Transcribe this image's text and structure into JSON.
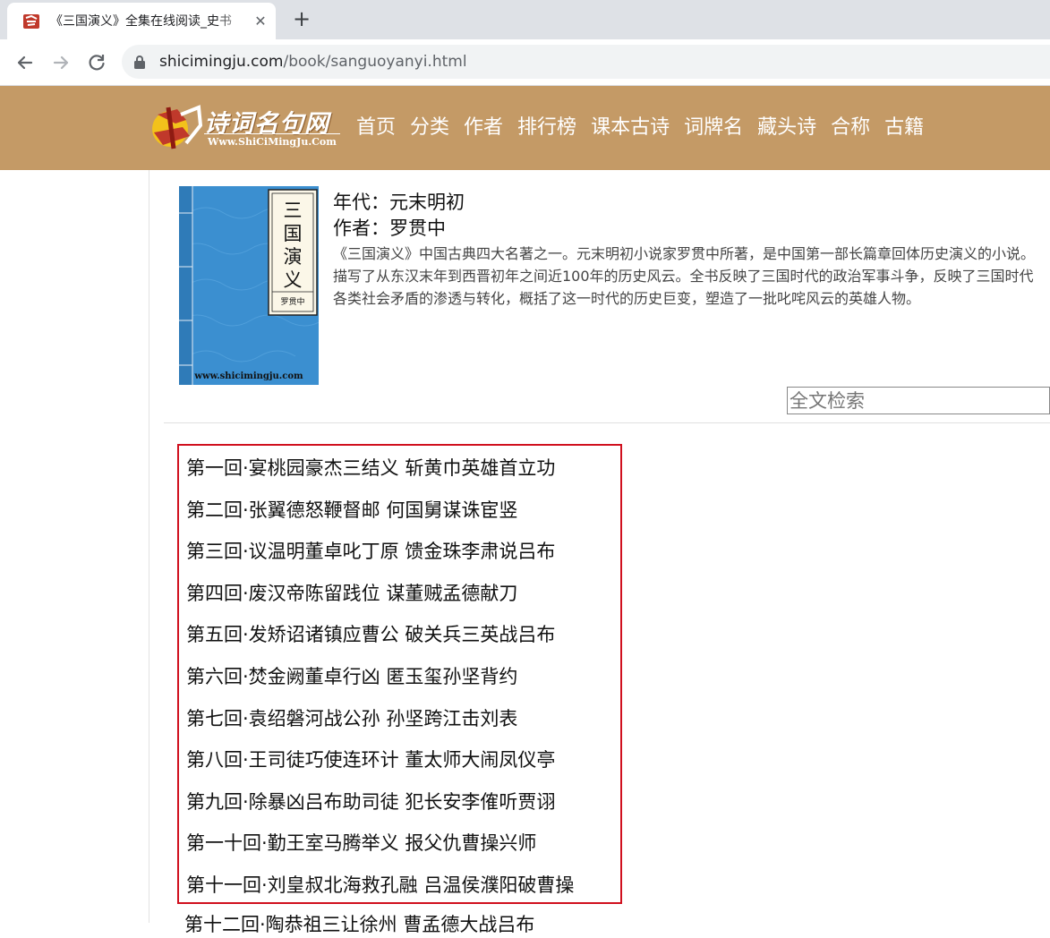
{
  "browser": {
    "tab_title": "《三国演义》全集在线阅读_史书",
    "close_glyph": "✕",
    "new_tab_glyph": "+",
    "url_host": "shicimingju.com",
    "url_path": "/book/sanguoyanyi.html"
  },
  "site": {
    "logo_text": "诗词名句网",
    "logo_url": "Www.ShiCiMingJu.Com",
    "nav": [
      "首页",
      "分类",
      "作者",
      "排行榜",
      "课本古诗",
      "词牌名",
      "藏头诗",
      "合称",
      "古籍"
    ]
  },
  "book": {
    "cover_title_chars": [
      "三",
      "国",
      "演",
      "义"
    ],
    "cover_author": "罗贯中",
    "cover_site": "www.shicimingju.com",
    "era_line": "年代：元末明初",
    "author_line": "作者：罗贯中",
    "description": "《三国演义》中国古典四大名著之一。元末明初小说家罗贯中所著，是中国第一部长篇章回体历史演义的小说。描写了从东汉末年到西晋初年之间近100年的历史风云。全书反映了三国时代的政治军事斗争，反映了三国时代各类社会矛盾的渗透与转化，概括了这一时代的历史巨变，塑造了一批叱咤风云的英雄人物。"
  },
  "search": {
    "placeholder": "全文检索"
  },
  "chapters": [
    "第一回·宴桃园豪杰三结义 斩黄巾英雄首立功",
    "第二回·张翼德怒鞭督邮 何国舅谋诛宦竖",
    "第三回·议温明董卓叱丁原 馈金珠李肃说吕布",
    "第四回·废汉帝陈留践位 谋董贼孟德献刀",
    "第五回·发矫诏诸镇应曹公 破关兵三英战吕布",
    "第六回·焚金阙董卓行凶 匿玉玺孙坚背约",
    "第七回·袁绍磐河战公孙 孙坚跨江击刘表",
    "第八回·王司徒巧使连环计 董太师大闹凤仪亭",
    "第九回·除暴凶吕布助司徒 犯长安李傕听贾诩",
    "第一十回·勤王室马腾举义 报父仇曹操兴师",
    "第十一回·刘皇叔北海救孔融 吕温侯濮阳破曹操"
  ],
  "chapter_peek": "第十二回·陶恭祖三让徐州 曹孟德大战吕布",
  "colors": {
    "header_bg": "#c49a66",
    "highlight_border": "#d0101e",
    "cover_blue": "#3b8fd0"
  }
}
